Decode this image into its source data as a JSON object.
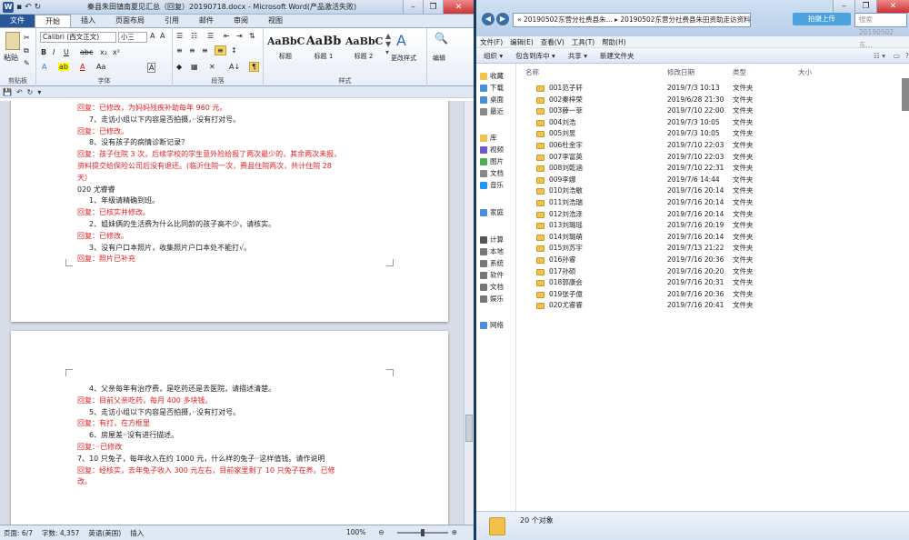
{
  "word": {
    "title": "秦县朱田镇南夏见汇总（回复）20190718.docx - Microsoft Word(产品激活失败)",
    "tabs": [
      "文件",
      "开始",
      "插入",
      "页面布局",
      "引用",
      "邮件",
      "审阅",
      "视图"
    ],
    "font_name": "Calibri (西文正文)",
    "font_size": "小三",
    "paste_label": "粘贴",
    "styles": [
      {
        "preview": "AaBbC",
        "name": "标题"
      },
      {
        "preview": "AaBb",
        "name": "标题 1"
      },
      {
        "preview": "AaBbC",
        "name": "标题 2"
      }
    ],
    "change_styles": "更改样式",
    "edit_label": "编辑",
    "groups": {
      "clipboard": "剪贴板",
      "font": "字体",
      "paragraph": "段落",
      "styles": "样式"
    },
    "page1_lines": [
      {
        "t": "回复：已修改，为妈妈残疾补助每年 960 元。",
        "red": true
      },
      {
        "t": "7、走访小组以下内容是否拍摄，··没有打对号。",
        "red": false
      },
      {
        "t": "回复：已修改。",
        "red": true
      },
      {
        "t": "8、没有孩子的病情诊断记录？",
        "red": false
      },
      {
        "t": "回复：孩子住院 3 次，后续学校的学生意外险给报了两次最少的，其余两次未报，",
        "red": true
      },
      {
        "t": "资料提交给保险公司后没有退还。(临沂住院一次，费县住院两次，共计住院 28",
        "red": true
      },
      {
        "t": "天）",
        "red": true
      },
      {
        "t": "020 尤睿睿",
        "red": false
      },
      {
        "t": "1、年级请精确到班。",
        "red": false
      },
      {
        "t": "回复：已核实并修改。",
        "red": true
      },
      {
        "t": "2、姐妹俩的生活费为什么比同龄的孩子高不少，请核实。",
        "red": false
      },
      {
        "t": "回复：已修改。",
        "red": true
      },
      {
        "t": "3、没有户口本照片，收集照片户口本处不能打√。",
        "red": false
      },
      {
        "t": "回复：照片已补充",
        "red": true
      }
    ],
    "page2_lines": [
      {
        "t": "4、父亲每年有治疗费，是吃药还是去医院，请描述清楚。",
        "red": false
      },
      {
        "t": "回复：目前父亲吃药，每月 400 多块钱。",
        "red": true
      },
      {
        "t": "5、走访小组以下内容是否拍摄，··没有打对号。",
        "red": false
      },
      {
        "t": "回复：有打，在方框里",
        "red": true
      },
      {
        "t": "6、房屋差··没有进行描述。",
        "red": false
      },
      {
        "t": "回复：··已修改",
        "red": true
      },
      {
        "t": "7、10 只兔子，每年收入在约 1000 元，什么样的兔子··这样值钱。请作说明",
        "red": false
      },
      {
        "t": "回复：经核实，去年兔子收入 300 元左右，目前家里剩了 10 只兔子在养。已修",
        "red": true
      },
      {
        "t": "改。",
        "red": true
      }
    ],
    "status": {
      "page": "页面: 6/7",
      "words": "字数: 4,357",
      "lang": "英语(美国)",
      "mode": "插入",
      "zoom": "100%"
    }
  },
  "explorer": {
    "address": "« 20190502东营分社费县朱... ▸ 20190502东营分社费县朱田资助走访资料（需复审）▸",
    "search_placeholder": "搜索 20190502东...",
    "upload": "拍摄上传",
    "menu": [
      "文件(F)",
      "编辑(E)",
      "查看(V)",
      "工具(T)",
      "帮助(H)"
    ],
    "commands": [
      "组织 ▾",
      "包含到库中 ▾",
      "共享 ▾",
      "新建文件夹"
    ],
    "columns": {
      "name": "名称",
      "date": "修改日期",
      "type": "类型",
      "size": "大小"
    },
    "nav": [
      "收藏",
      "下载",
      "桌面",
      "最近",
      "库",
      "视频",
      "图片",
      "文档",
      "音乐",
      "家庭",
      "计算",
      "本地",
      "系统",
      "软件",
      "文档",
      "娱乐",
      "网络"
    ],
    "files": [
      {
        "name": "001范子轩",
        "date": "2019/7/3 10:13",
        "type": "文件夹"
      },
      {
        "name": "002秦梓荣",
        "date": "2019/6/28 21:30",
        "type": "文件夹"
      },
      {
        "name": "003薛一菲",
        "date": "2019/7/10 22:00",
        "type": "文件夹"
      },
      {
        "name": "004刘浩",
        "date": "2019/7/3 10:05",
        "type": "文件夹"
      },
      {
        "name": "005刘昱",
        "date": "2019/7/3 10:05",
        "type": "文件夹"
      },
      {
        "name": "006杜金宇",
        "date": "2019/7/10 22:03",
        "type": "文件夹"
      },
      {
        "name": "007李富英",
        "date": "2019/7/10 22:03",
        "type": "文件夹"
      },
      {
        "name": "008刘乾涵",
        "date": "2019/7/10 22:31",
        "type": "文件夹"
      },
      {
        "name": "009李娜",
        "date": "2019/7/6 14:44",
        "type": "文件夹"
      },
      {
        "name": "010刘浩敏",
        "date": "2019/7/16 20:14",
        "type": "文件夹"
      },
      {
        "name": "011刘浩瑞",
        "date": "2019/7/16 20:14",
        "type": "文件夹"
      },
      {
        "name": "012刘浩泽",
        "date": "2019/7/16 20:14",
        "type": "文件夹"
      },
      {
        "name": "013刘璐瑶",
        "date": "2019/7/16 20:19",
        "type": "文件夹"
      },
      {
        "name": "014刘璐萌",
        "date": "2019/7/16 20:14",
        "type": "文件夹"
      },
      {
        "name": "015刘苏宇",
        "date": "2019/7/13 21:22",
        "type": "文件夹"
      },
      {
        "name": "016孙睿",
        "date": "2019/7/16 20:36",
        "type": "文件夹"
      },
      {
        "name": "017孙硕",
        "date": "2019/7/16 20:20",
        "type": "文件夹"
      },
      {
        "name": "018郭康会",
        "date": "2019/7/16 20:31",
        "type": "文件夹"
      },
      {
        "name": "019张子億",
        "date": "2019/7/16 20:36",
        "type": "文件夹"
      },
      {
        "name": "020尤睿睿",
        "date": "2019/7/16 20:41",
        "type": "文件夹"
      }
    ],
    "count": "20 个对象"
  }
}
